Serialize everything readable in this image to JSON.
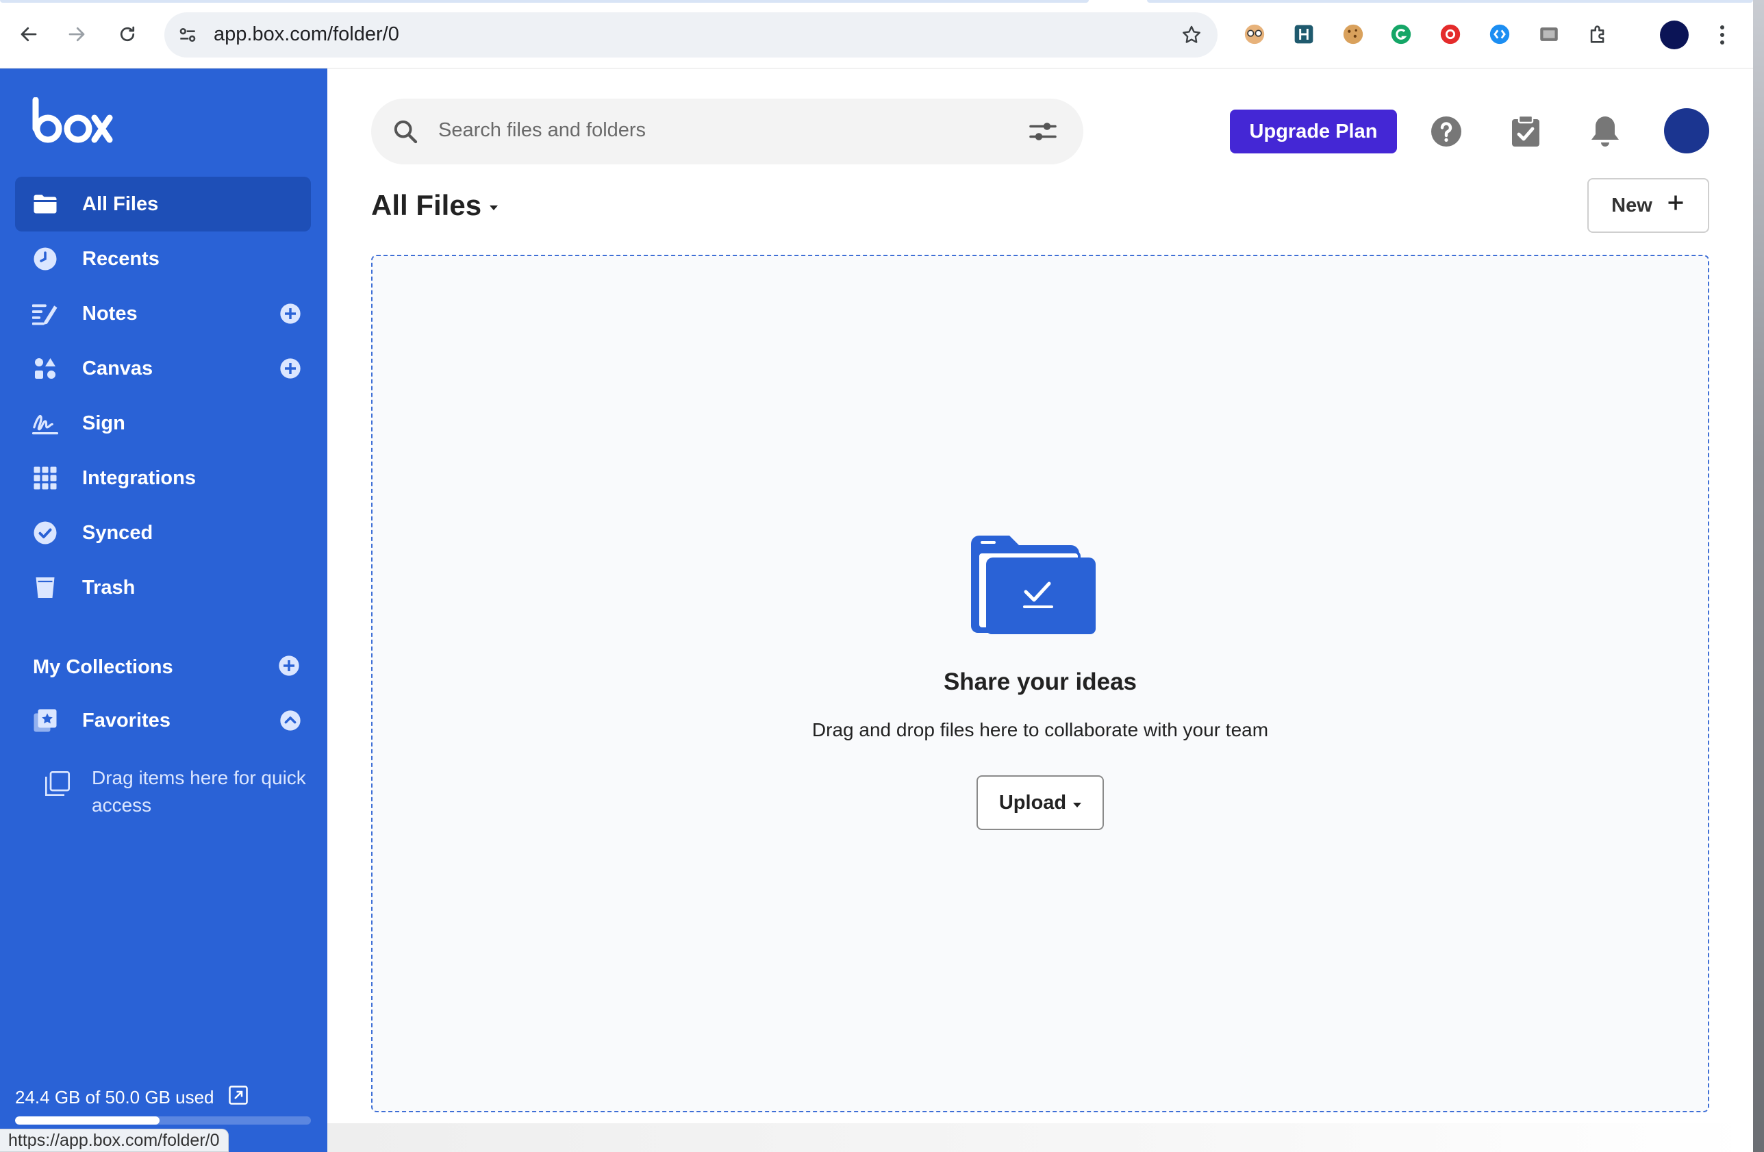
{
  "browser": {
    "url": "app.box.com/folder/0",
    "status_url": "https://app.box.com/folder/0"
  },
  "sidebar": {
    "items": [
      {
        "label": "All Files",
        "icon": "folder-icon",
        "active": true
      },
      {
        "label": "Recents",
        "icon": "clock-icon"
      },
      {
        "label": "Notes",
        "icon": "notes-icon"
      },
      {
        "label": "Canvas",
        "icon": "canvas-icon"
      },
      {
        "label": "Sign",
        "icon": "signature-icon"
      },
      {
        "label": "Integrations",
        "icon": "grid-icon"
      },
      {
        "label": "Synced",
        "icon": "check-circle-icon"
      },
      {
        "label": "Trash",
        "icon": "trash-icon"
      }
    ],
    "collections_title": "My Collections",
    "favorites_label": "Favorites",
    "drag_hint": "Drag items here for quick access",
    "storage_text": "24.4 GB of 50.0 GB used",
    "storage_used_fraction": 0.488
  },
  "header": {
    "search_placeholder": "Search files and folders",
    "upgrade_label": "Upgrade Plan"
  },
  "main": {
    "title": "All Files",
    "new_label": "New",
    "empty_title": "Share your ideas",
    "empty_subtitle": "Drag and drop files here to collaborate with your team",
    "upload_label": "Upload"
  },
  "colors": {
    "sidebar": "#2a62d6",
    "sidebar_active": "#1e4fb7",
    "upgrade": "#4427d5",
    "dropzone_border": "#3f6fd6"
  }
}
